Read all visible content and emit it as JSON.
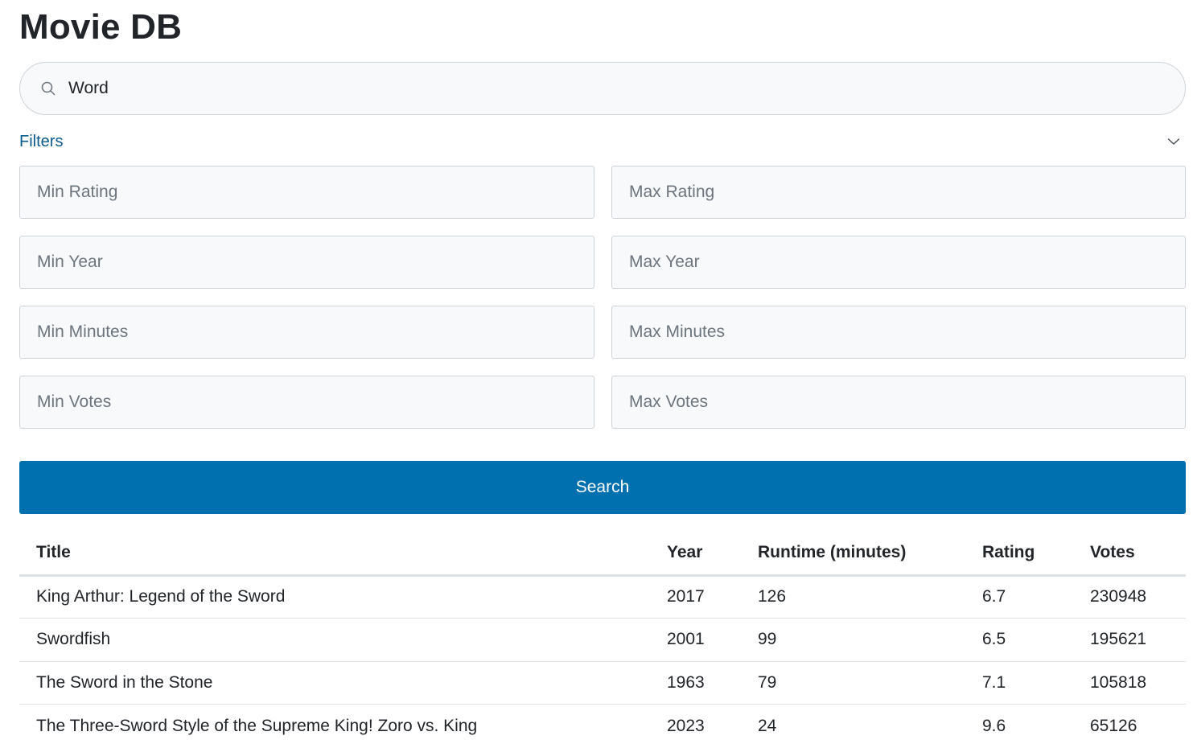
{
  "app": {
    "title": "Movie DB"
  },
  "search": {
    "value": "Word",
    "icon": "search-icon"
  },
  "filters": {
    "label": "Filters",
    "toggle_icon": "chevron-down-icon",
    "fields": [
      {
        "name": "min-rating",
        "placeholder": "Min Rating",
        "value": ""
      },
      {
        "name": "max-rating",
        "placeholder": "Max Rating",
        "value": ""
      },
      {
        "name": "min-year",
        "placeholder": "Min Year",
        "value": ""
      },
      {
        "name": "max-year",
        "placeholder": "Max Year",
        "value": ""
      },
      {
        "name": "min-minutes",
        "placeholder": "Min Minutes",
        "value": ""
      },
      {
        "name": "max-minutes",
        "placeholder": "Max Minutes",
        "value": ""
      },
      {
        "name": "min-votes",
        "placeholder": "Min Votes",
        "value": ""
      },
      {
        "name": "max-votes",
        "placeholder": "Max Votes",
        "value": ""
      }
    ]
  },
  "search_button": {
    "label": "Search"
  },
  "results": {
    "columns": [
      "Title",
      "Year",
      "Runtime (minutes)",
      "Rating",
      "Votes"
    ],
    "rows": [
      {
        "title": "King Arthur: Legend of the Sword",
        "year": "2017",
        "runtime": "126",
        "rating": "6.7",
        "votes": "230948"
      },
      {
        "title": "Swordfish",
        "year": "2001",
        "runtime": "99",
        "rating": "6.5",
        "votes": "195621"
      },
      {
        "title": "The Sword in the Stone",
        "year": "1963",
        "runtime": "79",
        "rating": "7.1",
        "votes": "105818"
      },
      {
        "title": "The Three-Sword Style of the Supreme King! Zoro vs. King",
        "year": "2023",
        "runtime": "24",
        "rating": "9.6",
        "votes": "65126"
      }
    ]
  },
  "colors": {
    "accent": "#0071ae",
    "link": "#0a5a8c",
    "text": "#212529",
    "placeholder": "#6c757d",
    "border": "#ced4da"
  }
}
